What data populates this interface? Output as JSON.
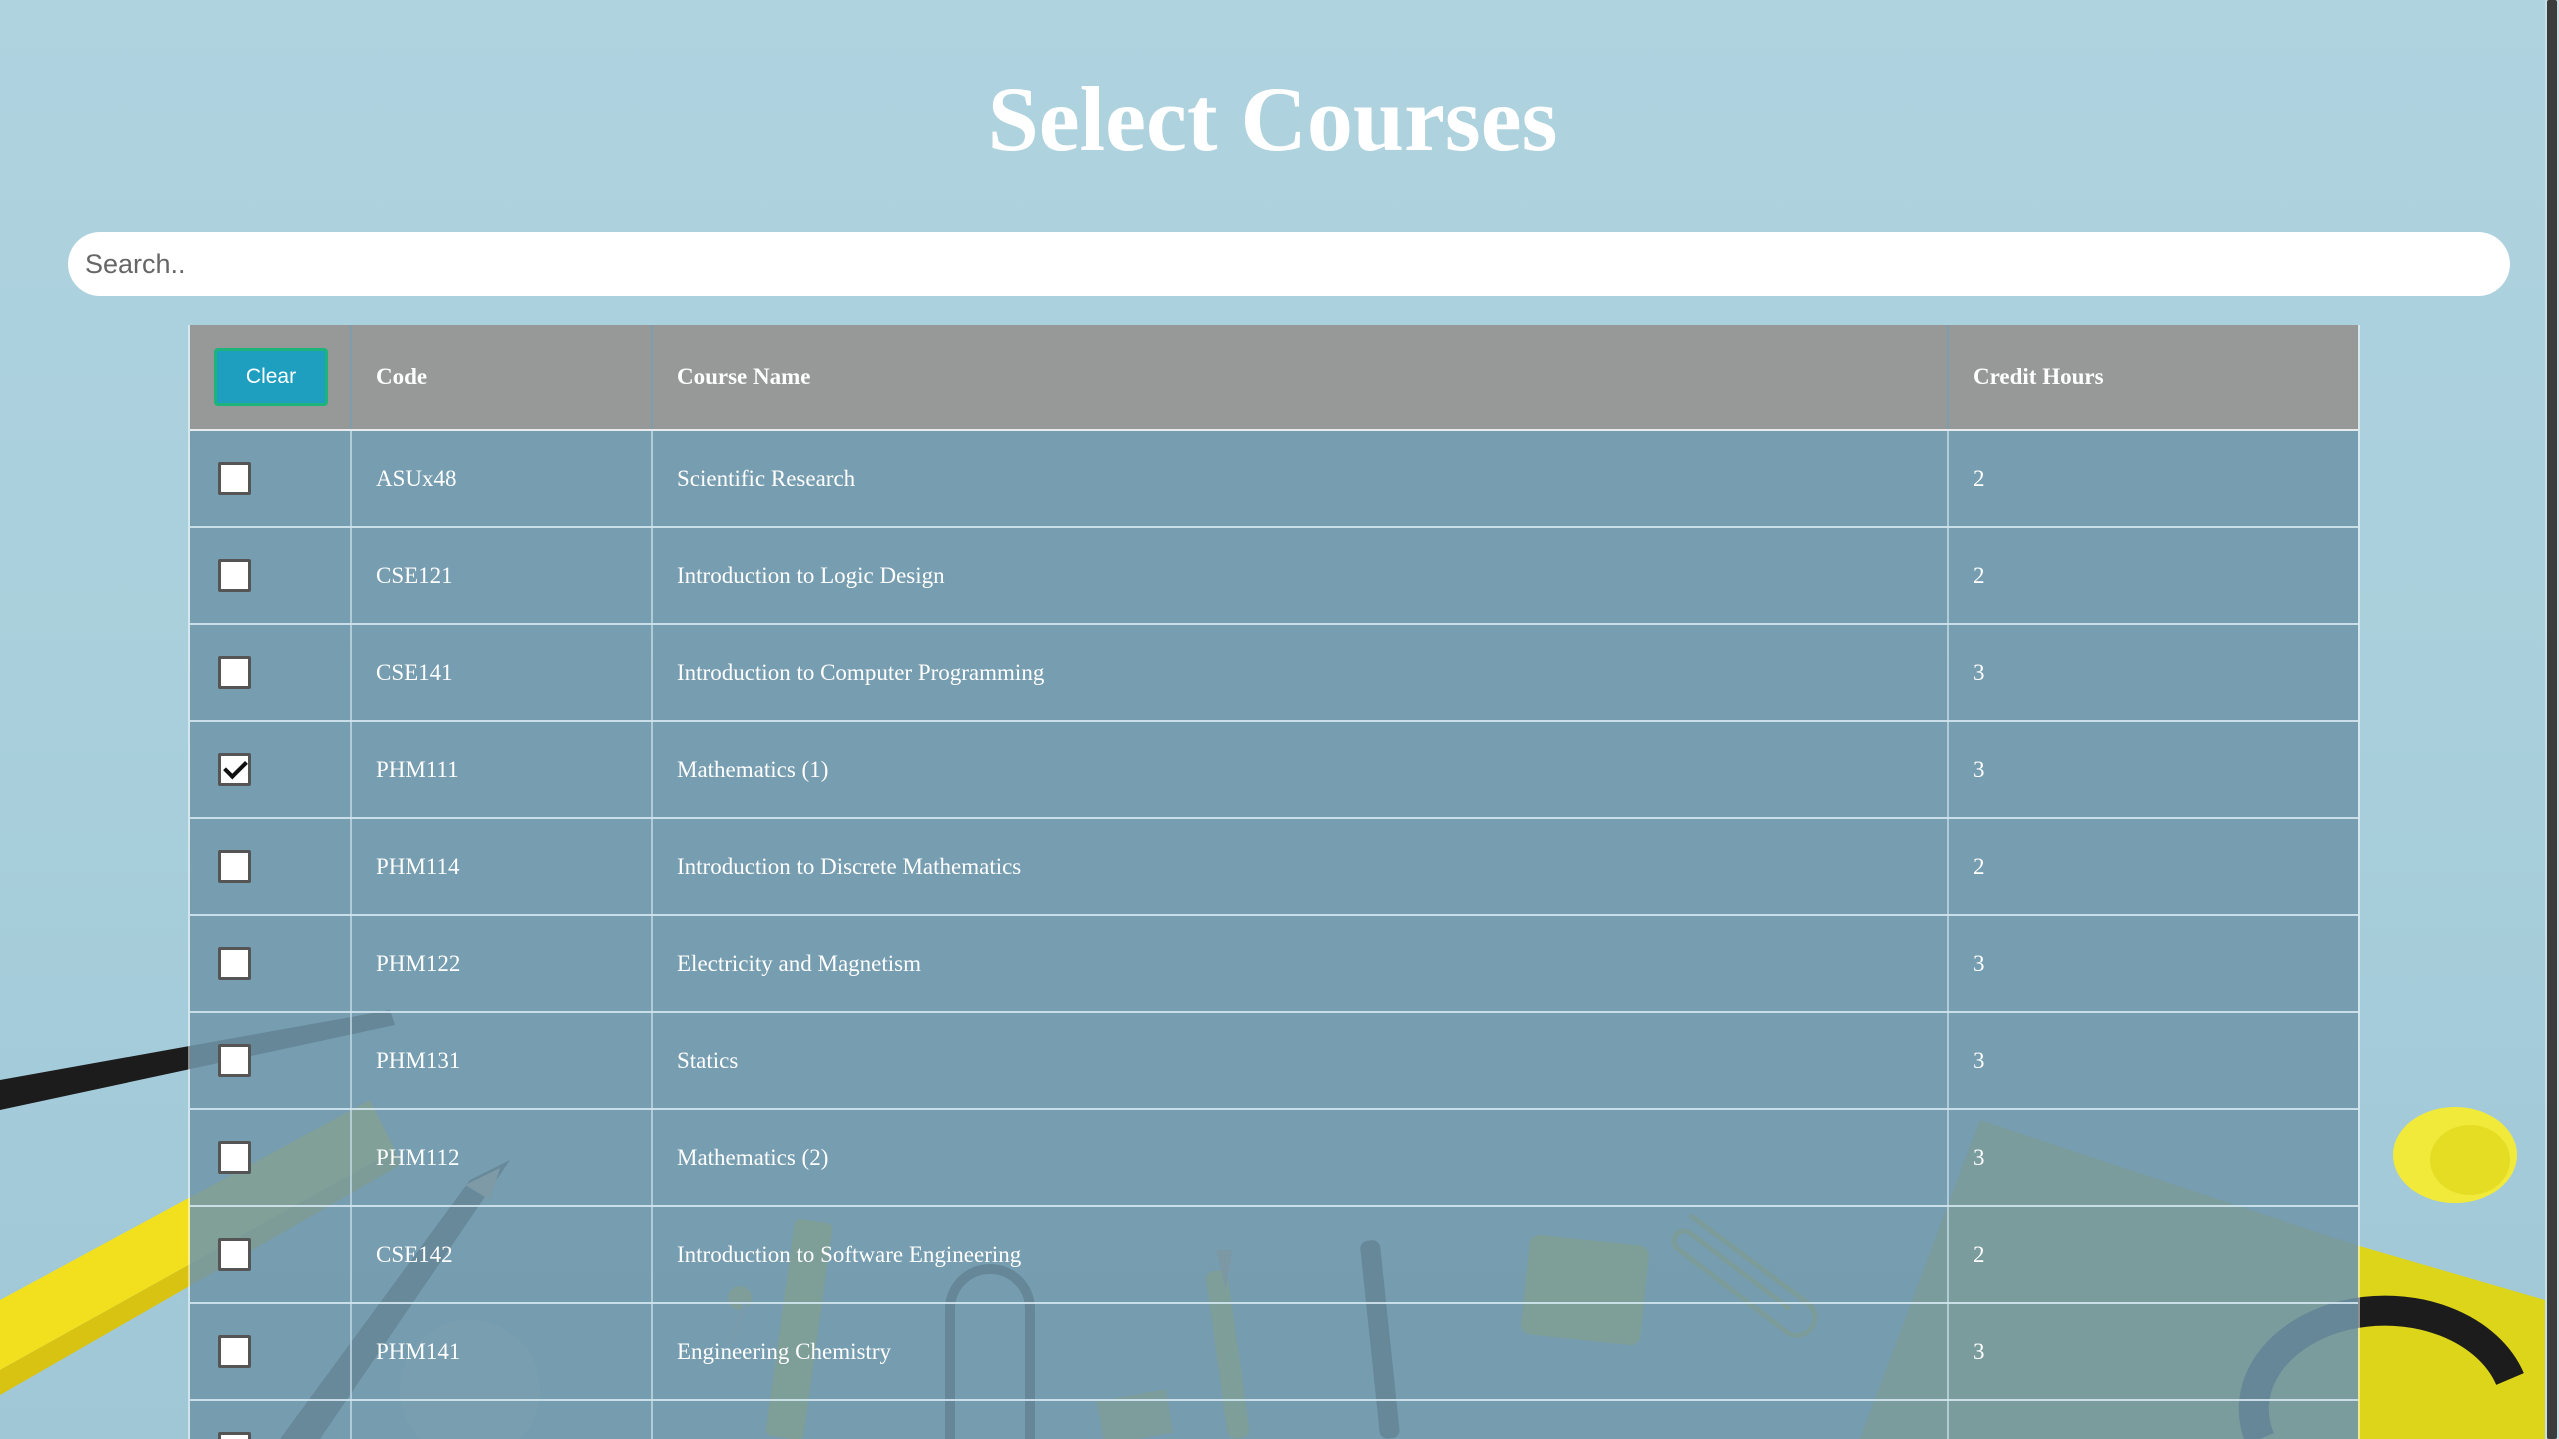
{
  "page": {
    "title": "Select Courses"
  },
  "search": {
    "placeholder": "Search.."
  },
  "table": {
    "clear_label": "Clear",
    "headers": {
      "code": "Code",
      "name": "Course Name",
      "hours": "Credit Hours"
    },
    "rows": [
      {
        "code": "ASUx48",
        "name": "Scientific Research",
        "hours": "2",
        "checked": false
      },
      {
        "code": "CSE121",
        "name": "Introduction to Logic Design",
        "hours": "2",
        "checked": false
      },
      {
        "code": "CSE141",
        "name": "Introduction to Computer Programming",
        "hours": "3",
        "checked": false
      },
      {
        "code": "PHM111",
        "name": "Mathematics (1)",
        "hours": "3",
        "checked": true
      },
      {
        "code": "PHM114",
        "name": "Introduction to Discrete Mathematics",
        "hours": "2",
        "checked": false
      },
      {
        "code": "PHM122",
        "name": "Electricity and Magnetism",
        "hours": "3",
        "checked": false
      },
      {
        "code": "PHM131",
        "name": "Statics",
        "hours": "3",
        "checked": false
      },
      {
        "code": "PHM112",
        "name": "Mathematics (2)",
        "hours": "3",
        "checked": false
      },
      {
        "code": "CSE142",
        "name": "Introduction to Software Engineering",
        "hours": "2",
        "checked": false
      },
      {
        "code": "PHM141",
        "name": "Engineering Chemistry",
        "hours": "3",
        "checked": false
      },
      {
        "code": "",
        "name": "",
        "hours": "",
        "checked": false
      }
    ]
  },
  "colors": {
    "accent_button": "#1f9fc0",
    "button_border": "#1cb47a",
    "header_bg": "#969696",
    "row_bg": "#7096aa",
    "page_bg": "#acd0dc"
  }
}
